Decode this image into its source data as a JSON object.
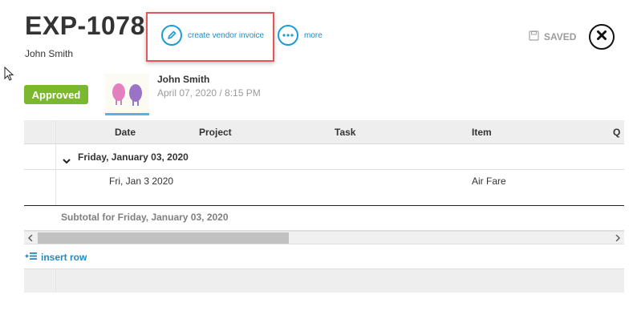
{
  "header": {
    "title": "EXP-1078",
    "user_name": "John Smith",
    "create_vendor_invoice_label": "create vendor invoice",
    "more_label": "more",
    "saved_label": "SAVED"
  },
  "status": {
    "label": "Approved",
    "color": "#7cb82f"
  },
  "submission": {
    "name": "John Smith",
    "timestamp": "April 07, 2020 / 8:15 PM"
  },
  "table": {
    "columns": [
      "Date",
      "Project",
      "Task",
      "Item",
      "Q"
    ],
    "group": {
      "label": "Friday, January 03, 2020"
    },
    "rows": [
      {
        "date": "Fri, Jan 3 2020",
        "project": "",
        "task": "",
        "item": "Air Fare"
      }
    ],
    "subtotal_label": "Subtotal for Friday, January 03, 2020"
  },
  "actions": {
    "insert_row_label": "insert row"
  },
  "colors": {
    "accent": "#1e9ad6",
    "highlight": "#e2575a",
    "muted": "#9b9b9b"
  }
}
